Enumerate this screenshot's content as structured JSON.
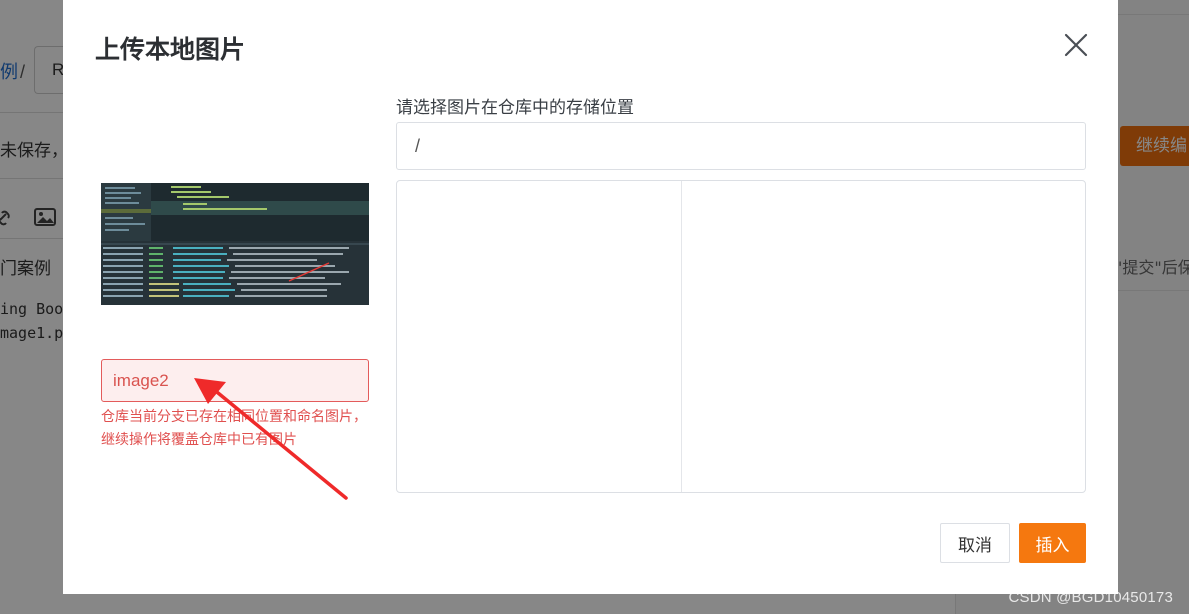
{
  "background": {
    "breadcrumb_fragment": "例",
    "breadcrumb_separator": "/",
    "input_fragment": "R",
    "unsaved_fragment": "未保存，",
    "case_fragment": "门案例",
    "code_lines": [
      "ing Boo",
      "mage1.p"
    ],
    "continue_button_fragment": "继续编",
    "hint_fragment": "\"提交\"后保"
  },
  "modal": {
    "title": "上传本地图片",
    "close_icon": "close-icon",
    "image_name_value": "image2",
    "image_name_error": "仓库当前分支已存在相同位置和命名图片，继续操作将覆盖仓库中已有图片",
    "path_label": "请选择图片在仓库中的存储位置",
    "path_value": "/",
    "cancel_label": "取消",
    "insert_label": "插入"
  },
  "watermark": "CSDN @BGD10450173",
  "colors": {
    "accent": "#f5780f",
    "error": "#e0504f",
    "arrow": "#ef2a2a"
  }
}
